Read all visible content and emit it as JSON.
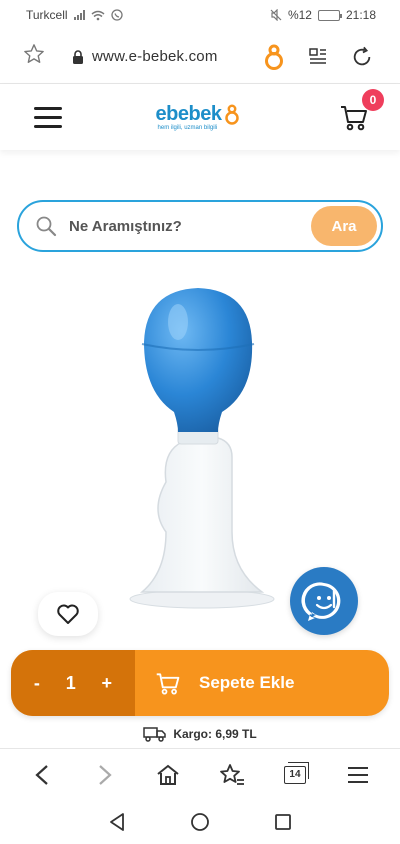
{
  "status_bar": {
    "carrier": "Turkcell",
    "battery": "%12",
    "battery_level": 0.12,
    "time": "21:18"
  },
  "browser": {
    "url": "www.e-bebek.com",
    "tabs_count": "14"
  },
  "header": {
    "logo_text": "ebebek",
    "logo_tagline": "hem ilgili, uzman bilgili",
    "cart_count": "0"
  },
  "search": {
    "placeholder": "Ne Aramıştınız?",
    "button_label": "Ara"
  },
  "cart_bar": {
    "minus": "-",
    "quantity": "1",
    "plus": "+",
    "add_label": "Sepete Ekle"
  },
  "shipping": {
    "label": "Kargo: 6,99 TL"
  },
  "colors": {
    "brand_blue": "#1d8ec9",
    "accent_orange": "#f7941d",
    "qty_orange": "#d4730a",
    "badge_red": "#ef3e5c",
    "search_button": "#f8b66d"
  },
  "icons": [
    "star-icon",
    "lock-icon",
    "ebebek-app-icon",
    "reader-icon",
    "reload-icon",
    "menu-icon",
    "stroller-cart-icon",
    "search-icon",
    "heart-icon",
    "chat-icon",
    "truck-icon",
    "back-icon",
    "forward-icon",
    "home-icon",
    "bookmark-star-icon",
    "tabs-icon",
    "more-icon"
  ]
}
